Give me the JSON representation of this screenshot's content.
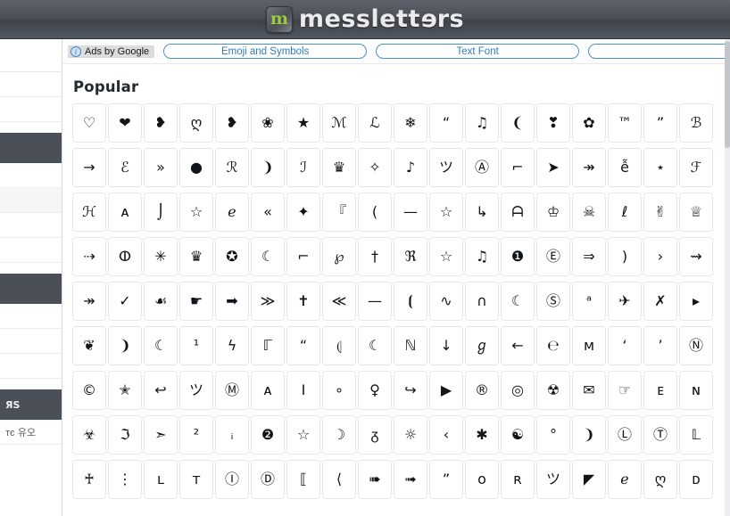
{
  "header": {
    "logo_glyph": "m",
    "logo_text_start": "messlett",
    "logo_text_flip": "e",
    "logo_text_end": "rs",
    "title": "messletters"
  },
  "ads": {
    "info_icon": "info-icon",
    "label": "Ads by Google",
    "links": [
      "Emoji and Symbols",
      "Text Font",
      ""
    ]
  },
  "sidebar": {
    "band_label_partial": "ЯS",
    "korean_row": "тє 유오",
    "rows": [
      "",
      "",
      "",
      "",
      "",
      ""
    ]
  },
  "main": {
    "section_title": "Popular"
  },
  "symbols": {
    "rows": [
      [
        "♡",
        "❤",
        "❥",
        "ღ",
        "❥",
        "❀",
        "★",
        "ℳ",
        "ℒ",
        "❄",
        "“",
        "♫",
        "❨",
        "❣",
        "✿",
        "™",
        "”",
        "ℬ"
      ],
      [
        "→",
        "ℰ",
        "»",
        "●",
        "ℛ",
        "❩",
        "ℐ",
        "♛",
        "✧",
        "♪",
        "ツ",
        "Ⓐ",
        "⌐",
        "➤",
        "↠",
        "ễ",
        "⋆",
        "ℱ"
      ],
      [
        "ℋ",
        "ᴀ",
        "⌡",
        "☆",
        "ℯ",
        "«",
        "✦",
        "『",
        "(",
        "—",
        "☆",
        "↳",
        "ᗩ",
        "♔",
        "☠",
        "ℓ",
        "✌",
        "♕"
      ],
      [
        "⇢",
        "ⵀ",
        "✳",
        "♛",
        "✪",
        "☾",
        "⌐",
        "℘",
        "†",
        "ℜ",
        "☆",
        "♫",
        "❶",
        "Ⓔ",
        "⇒",
        ")",
        "›",
        "⇝"
      ],
      [
        "↠",
        "✓",
        "☙",
        "☛",
        "➡",
        "≫",
        "✝",
        "≪",
        "—",
        "⦗",
        "∿",
        "∩",
        "☾",
        "Ⓢ",
        "ᵃ",
        "✈",
        "✗",
        "▸"
      ],
      [
        "❦",
        "❩",
        "☾",
        "¹",
        "ϟ",
        "ℾ",
        "“",
        "⦇",
        "☾",
        "ℕ",
        "↓",
        "ℊ",
        "←",
        "℮",
        "ᴍ",
        "‘",
        "’",
        "Ⓝ"
      ],
      [
        "©",
        "✭",
        "↩",
        "ツ",
        "Ⓜ",
        "ᴀ",
        "I",
        "∘",
        "♀",
        "↪",
        "▶",
        "®",
        "◎",
        "☢",
        "✉",
        "☞",
        "ᴇ",
        "ɴ"
      ],
      [
        "☣",
        "ℑ",
        "➣",
        "²",
        "ᵢ",
        "❷",
        "☆",
        "☽",
        "ᵹ",
        "☼",
        "‹",
        "✱",
        "☯",
        "°",
        "❩",
        "Ⓛ",
        "Ⓣ",
        "𝕃"
      ],
      [
        "♰",
        "⋮",
        "ʟ",
        "ᴛ",
        "Ⓘ",
        "Ⓓ",
        "⟦",
        "⟨",
        "➠",
        "➟",
        "”",
        "ᴏ",
        "ʀ",
        "ツ",
        "◤",
        "ℯ",
        "ღ",
        "ᴅ"
      ]
    ]
  },
  "colors": {
    "header_bg": "#4c5058",
    "logo_green": "#9ccb3b",
    "link_blue": "#2e7cbb",
    "tile_border": "#e3e6ea",
    "sidebar_band": "#4a4f58"
  }
}
